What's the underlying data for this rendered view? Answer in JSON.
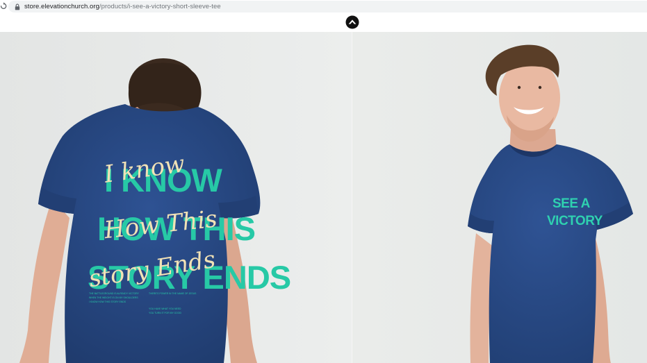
{
  "browser": {
    "url_host": "store.elevationchurch.org",
    "url_path": "/products/i-see-a-victory-short-sleeve-tee"
  },
  "site": {
    "logo_icon": "elevation-chevron-logo-icon"
  },
  "gallery": {
    "back_photo": {
      "shirt_color": "#2a4b86",
      "print_caps": [
        "I KNOW",
        "HOW THIS",
        "STORY ENDS"
      ],
      "print_script": [
        "I know",
        "How This",
        "story Ends"
      ],
      "fine_print": [
        "THE BATTLEGROUND IS ALREADY VICTORY",
        "WHEN THE WEIGHT IS ON MY SHOULDERS",
        "I KNOW HOW THIS STORY ENDS",
        "THERE'S POWER IN THE NAME OF JESUS",
        "YOU HAVE WHAT YOU NEED",
        "YOU TURN IT FOR MY GOOD"
      ]
    },
    "front_photo": {
      "shirt_color": "#2a4d8a",
      "chest_print": [
        "SEE A",
        "VICTORY"
      ]
    }
  }
}
